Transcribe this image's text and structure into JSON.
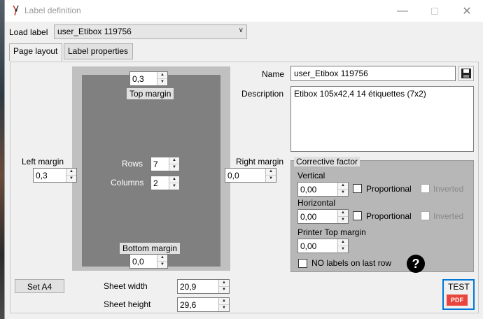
{
  "window": {
    "title": "Label definition",
    "minimize_icon": "minimize-icon",
    "maximize_icon": "maximize-icon",
    "close_icon": "close-icon"
  },
  "load_label": {
    "label": "Load label",
    "value": "user_Etibox 119756"
  },
  "tabs": [
    {
      "label": "Page layout",
      "active": true
    },
    {
      "label": "Label properties",
      "active": false
    }
  ],
  "layout": {
    "top_margin": {
      "value": "0,3",
      "caption": "Top margin"
    },
    "bottom_margin": {
      "value": "0,0",
      "caption": "Bottom margin"
    },
    "left_margin": {
      "caption": "Left margin",
      "value": "0,3"
    },
    "right_margin": {
      "caption": "Right margin",
      "value": "0,0"
    },
    "rows": {
      "caption": "Rows",
      "value": "7"
    },
    "columns": {
      "caption": "Columns",
      "value": "2"
    },
    "set_a4": "Set A4",
    "sheet_width": {
      "caption": "Sheet width",
      "value": "20,9"
    },
    "sheet_height": {
      "caption": "Sheet height",
      "value": "29,6"
    }
  },
  "details": {
    "name_label": "Name",
    "name_value": "user_Etibox 119756",
    "description_label": "Description",
    "description_value": "Etibox 105x42,4 14 étiquettes (7x2)"
  },
  "corrective": {
    "title": "Corrective factor",
    "vertical_label": "Vertical",
    "vertical_value": "0,00",
    "horizontal_label": "Horizontal",
    "horizontal_value": "0,00",
    "proportional_label": "Proportional",
    "inverted_label": "Inverted",
    "printer_top_label": "Printer Top margin",
    "printer_top_value": "0,00",
    "no_labels_last_row": "NO labels on last row"
  },
  "test_button": {
    "label": "TEST",
    "badge": "PDF"
  },
  "colors": {
    "accent": "#0078d7",
    "pdf_red": "#e8453c"
  }
}
